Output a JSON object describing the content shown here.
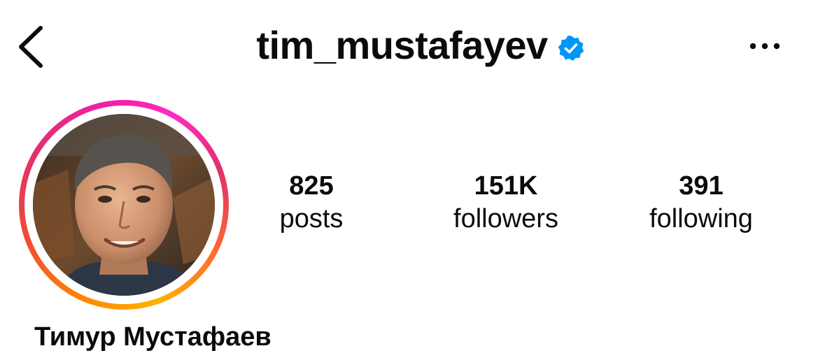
{
  "header": {
    "username": "tim_mustafayev",
    "verified": true,
    "back_icon": "chevron-left-icon",
    "more_icon": "more-horizontal-icon",
    "verified_icon": "verified-badge-icon"
  },
  "profile": {
    "full_name": "Тимур Мустафаев",
    "avatar": "profile-photo",
    "story_ring": true
  },
  "stats": {
    "posts": {
      "count": "825",
      "label": "posts"
    },
    "followers": {
      "count": "151K",
      "label": "followers"
    },
    "following": {
      "count": "391",
      "label": "following"
    }
  },
  "colors": {
    "text": "#0b0b0b",
    "verified_blue": "#0095f6",
    "ring_start": "#ffb300",
    "ring_mid": "#e1306c",
    "ring_end": "#ff2bc2",
    "background": "#ffffff"
  }
}
